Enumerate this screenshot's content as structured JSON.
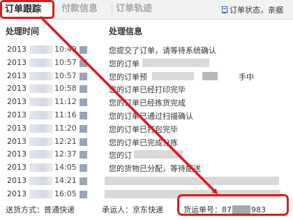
{
  "tabs": {
    "track": "订单跟踪",
    "payment": "付款信息",
    "trace": "订单轨迹"
  },
  "status_link": "订单状态，亲据",
  "headers": {
    "time": "处理时间",
    "info": "处理信息"
  },
  "rows": [
    {
      "year": "2013",
      "clock": "10:49",
      "info": "您提交了订单，请等待系统确认"
    },
    {
      "year": "2013",
      "clock": "10:57",
      "info": "您的订单"
    },
    {
      "year": "2013",
      "clock": "10:57",
      "info": "您的订单预",
      "tail": "手中"
    },
    {
      "year": "2013",
      "clock": "10:58",
      "info": "您的订单已经打印完毕"
    },
    {
      "year": "2013",
      "clock": "11:12",
      "info": "您的订单已经拣货完成"
    },
    {
      "year": "2013",
      "clock": "11:16",
      "info": "您的订单已通过扫描确认"
    },
    {
      "year": "2013",
      "clock": "11:20",
      "info": "您的订单已打包完毕"
    },
    {
      "year": "2013",
      "clock": "12:21",
      "info": "您的订单已完成分拣"
    },
    {
      "year": "2013",
      "clock": "12:37",
      "info": "您的订"
    },
    {
      "year": "2013",
      "clock": "14:05",
      "info": "您的货物已分配，等待配送"
    },
    {
      "year": "2013",
      "clock": "14:21",
      "info": ""
    },
    {
      "year": "2013",
      "clock": "16:05",
      "info": ""
    }
  ],
  "footer": {
    "ship_method": "送货方式：普通快递",
    "carrier": "承运人：京东快递",
    "tracking_label": "货运单号：",
    "tracking_start": "87",
    "tracking_end": "983"
  },
  "colors": {
    "highlight": "#d81b1b",
    "tab_bar": "#f2f2f2"
  }
}
